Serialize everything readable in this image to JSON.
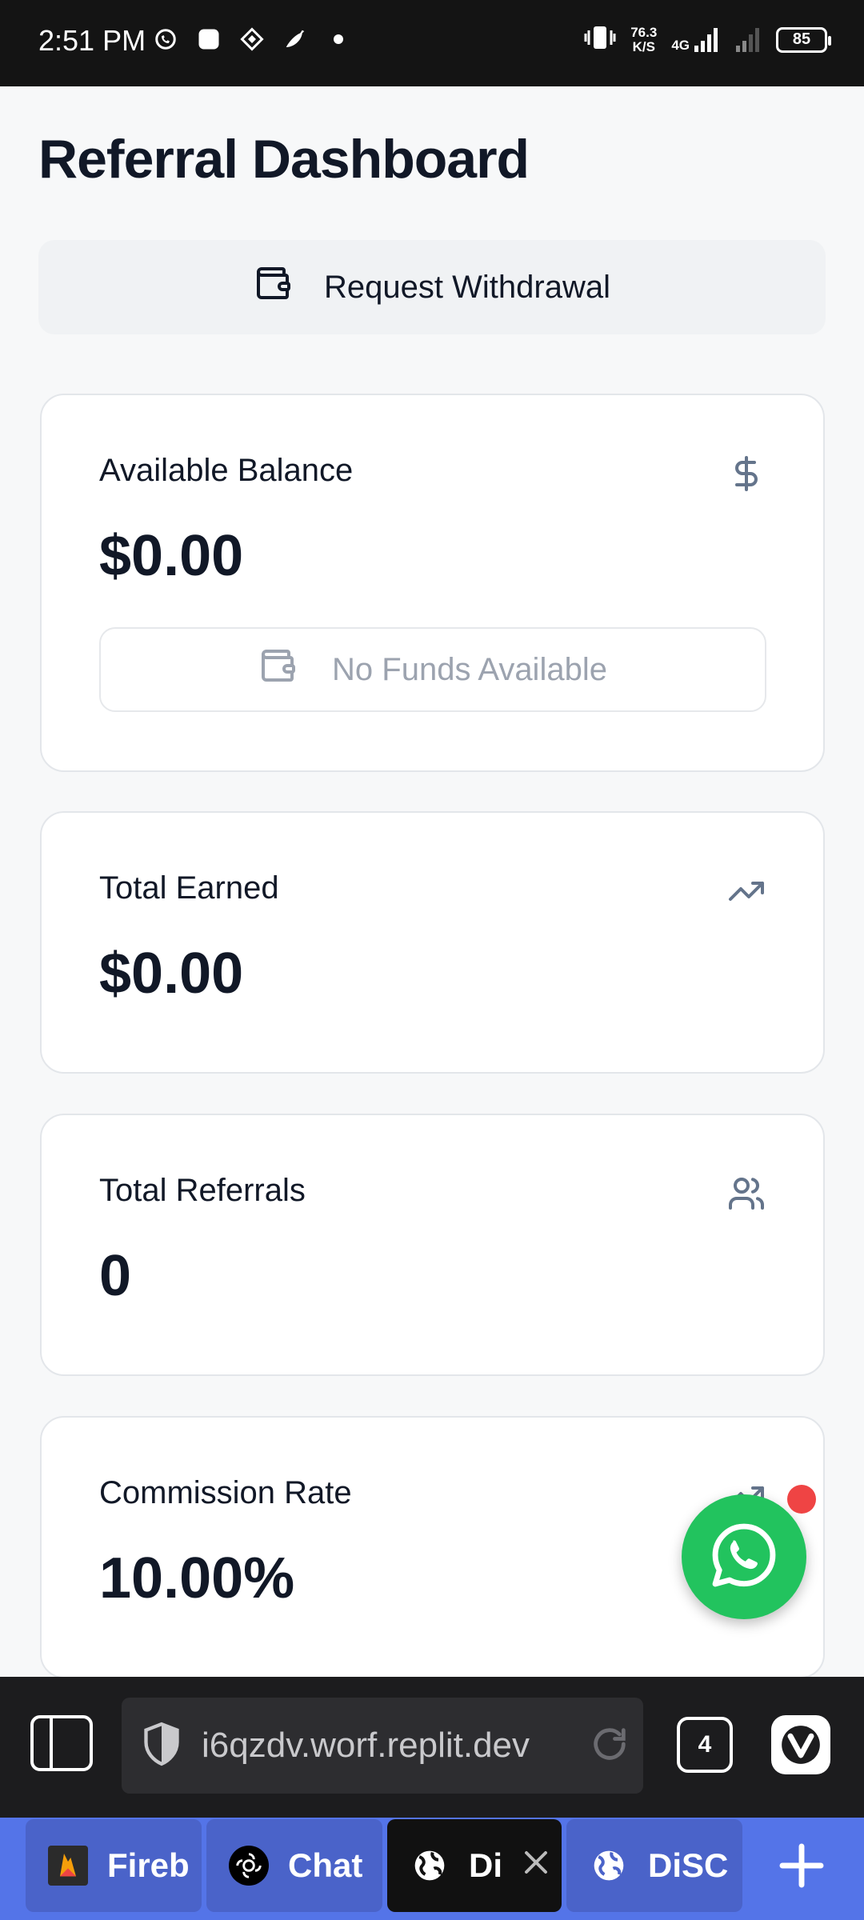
{
  "status_bar": {
    "time": "2:51 PM",
    "speed_value": "76.3",
    "speed_unit": "K/S",
    "network": "4G",
    "battery": "85"
  },
  "page": {
    "title": "Referral Dashboard",
    "withdraw_button_label": "Request Withdrawal"
  },
  "cards": {
    "available_balance": {
      "label": "Available Balance",
      "value": "$0.00",
      "button_label": "No Funds Available",
      "icon": "dollar-icon"
    },
    "total_earned": {
      "label": "Total Earned",
      "value": "$0.00",
      "icon": "trending-up-icon"
    },
    "total_referrals": {
      "label": "Total Referrals",
      "value": "0",
      "icon": "users-icon"
    },
    "commission_rate": {
      "label": "Commission Rate",
      "value": "10.00%",
      "icon": "trending-up-icon"
    }
  },
  "browser": {
    "url": "i6qzdv.worf.replit.dev",
    "tab_count": "4"
  },
  "tabs": [
    {
      "label": "Fireb",
      "favicon": "firebase-icon"
    },
    {
      "label": "Chat",
      "favicon": "chatgpt-icon"
    },
    {
      "label": "Di",
      "favicon": "globe-icon",
      "active": true
    },
    {
      "label": "DiSC",
      "favicon": "globe-icon"
    }
  ],
  "colors": {
    "accent_whatsapp": "#22c35e",
    "notification_dot": "#ef4444",
    "tabstrip": "#5474e8"
  }
}
